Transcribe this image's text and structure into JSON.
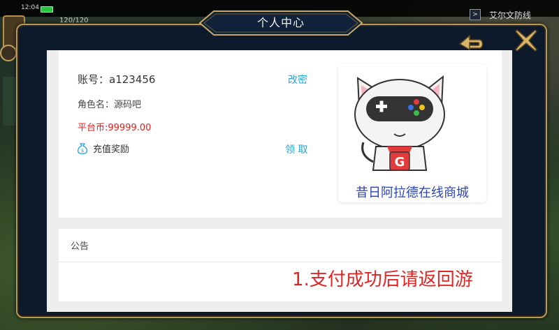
{
  "status_bar": {
    "time": "12:04",
    "stamina": "120/120",
    "region_toggle": ">",
    "region_name": "艾尔文防线"
  },
  "dialog": {
    "title": "个人中心",
    "back_icon": "back-arrow-icon",
    "close_icon": "close-x-icon"
  },
  "account": {
    "account_label": "账号：",
    "account_value": "a123456",
    "change_password": "改密",
    "role_label": "角色名：",
    "role_value": "源码吧",
    "coins_label": "平台币:",
    "coins_value": "99999.00",
    "reward_icon": "money-bag-icon",
    "reward_label": "充值奖励",
    "claim_label": "领 取"
  },
  "shop": {
    "name": "昔日阿拉德在线商城",
    "logo_letter": "G"
  },
  "notice": {
    "title": "公告",
    "text": "1.支付成功后请返回游"
  },
  "colors": {
    "link": "#1fa6d6",
    "coins": "#e02020",
    "shop_name": "#2b44b0",
    "notice_text": "#e12424",
    "frame_gold": "#b8975a",
    "frame_bg": "#0d1a2c"
  }
}
